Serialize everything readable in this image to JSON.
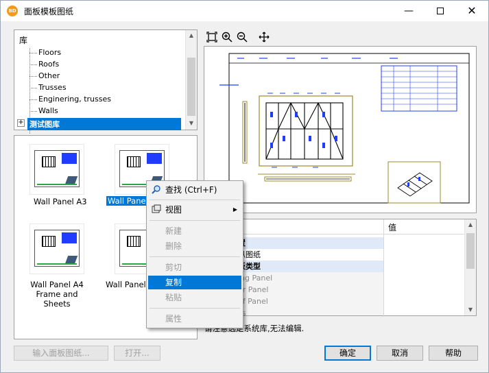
{
  "window": {
    "app_icon_text": "BD",
    "title": "面板模板图纸",
    "min_glyph": "—",
    "close_glyph": "✕"
  },
  "tree": {
    "root": "库",
    "items": [
      "Floors",
      "Roofs",
      "Other",
      "Trusses",
      "Enginering, trusses",
      "Walls"
    ],
    "expander": "+",
    "selected": "测试图库"
  },
  "thumbnails": [
    {
      "label": "Wall Panel A3"
    },
    {
      "label": "Wall Panel A"
    },
    {
      "label": "Wall Panel A4 Frame and Sheets"
    },
    {
      "label": "Wall Panel A"
    }
  ],
  "preview_toolbar": {
    "fit_icon": "fit-icon",
    "zoom_in_icon": "zoom-in-icon",
    "zoom_out_icon": "zoom-out-icon",
    "pan_icon": "pan-icon"
  },
  "properties": {
    "value_header": "值",
    "rows": [
      {
        "text": "置",
        "kind": "cat"
      },
      {
        "text": "纵图纸",
        "kind": "plain"
      },
      {
        "text": "板类型",
        "kind": "cat"
      },
      {
        "text": "ing Panel",
        "kind": "gray"
      },
      {
        "text": "or Panel",
        "kind": "gray"
      },
      {
        "text": "of Panel",
        "kind": "gray"
      },
      {
        "text": "ss",
        "kind": "gray"
      }
    ]
  },
  "status_text": "请注意选定系统库,无法编辑.",
  "context_menu": {
    "find": "查找 (Ctrl+F)",
    "view": "视图",
    "new": "新建",
    "delete": "删除",
    "cut": "剪切",
    "copy": "复制",
    "paste": "粘贴",
    "properties": "属性"
  },
  "buttons": {
    "import": "输入面板图纸...",
    "open": "打开...",
    "ok": "确定",
    "cancel": "取消",
    "help": "帮助"
  },
  "colors": {
    "selection": "#0078d7",
    "drawing_blue": "#1f3cff",
    "frame_olive": "#9c8a2a"
  }
}
